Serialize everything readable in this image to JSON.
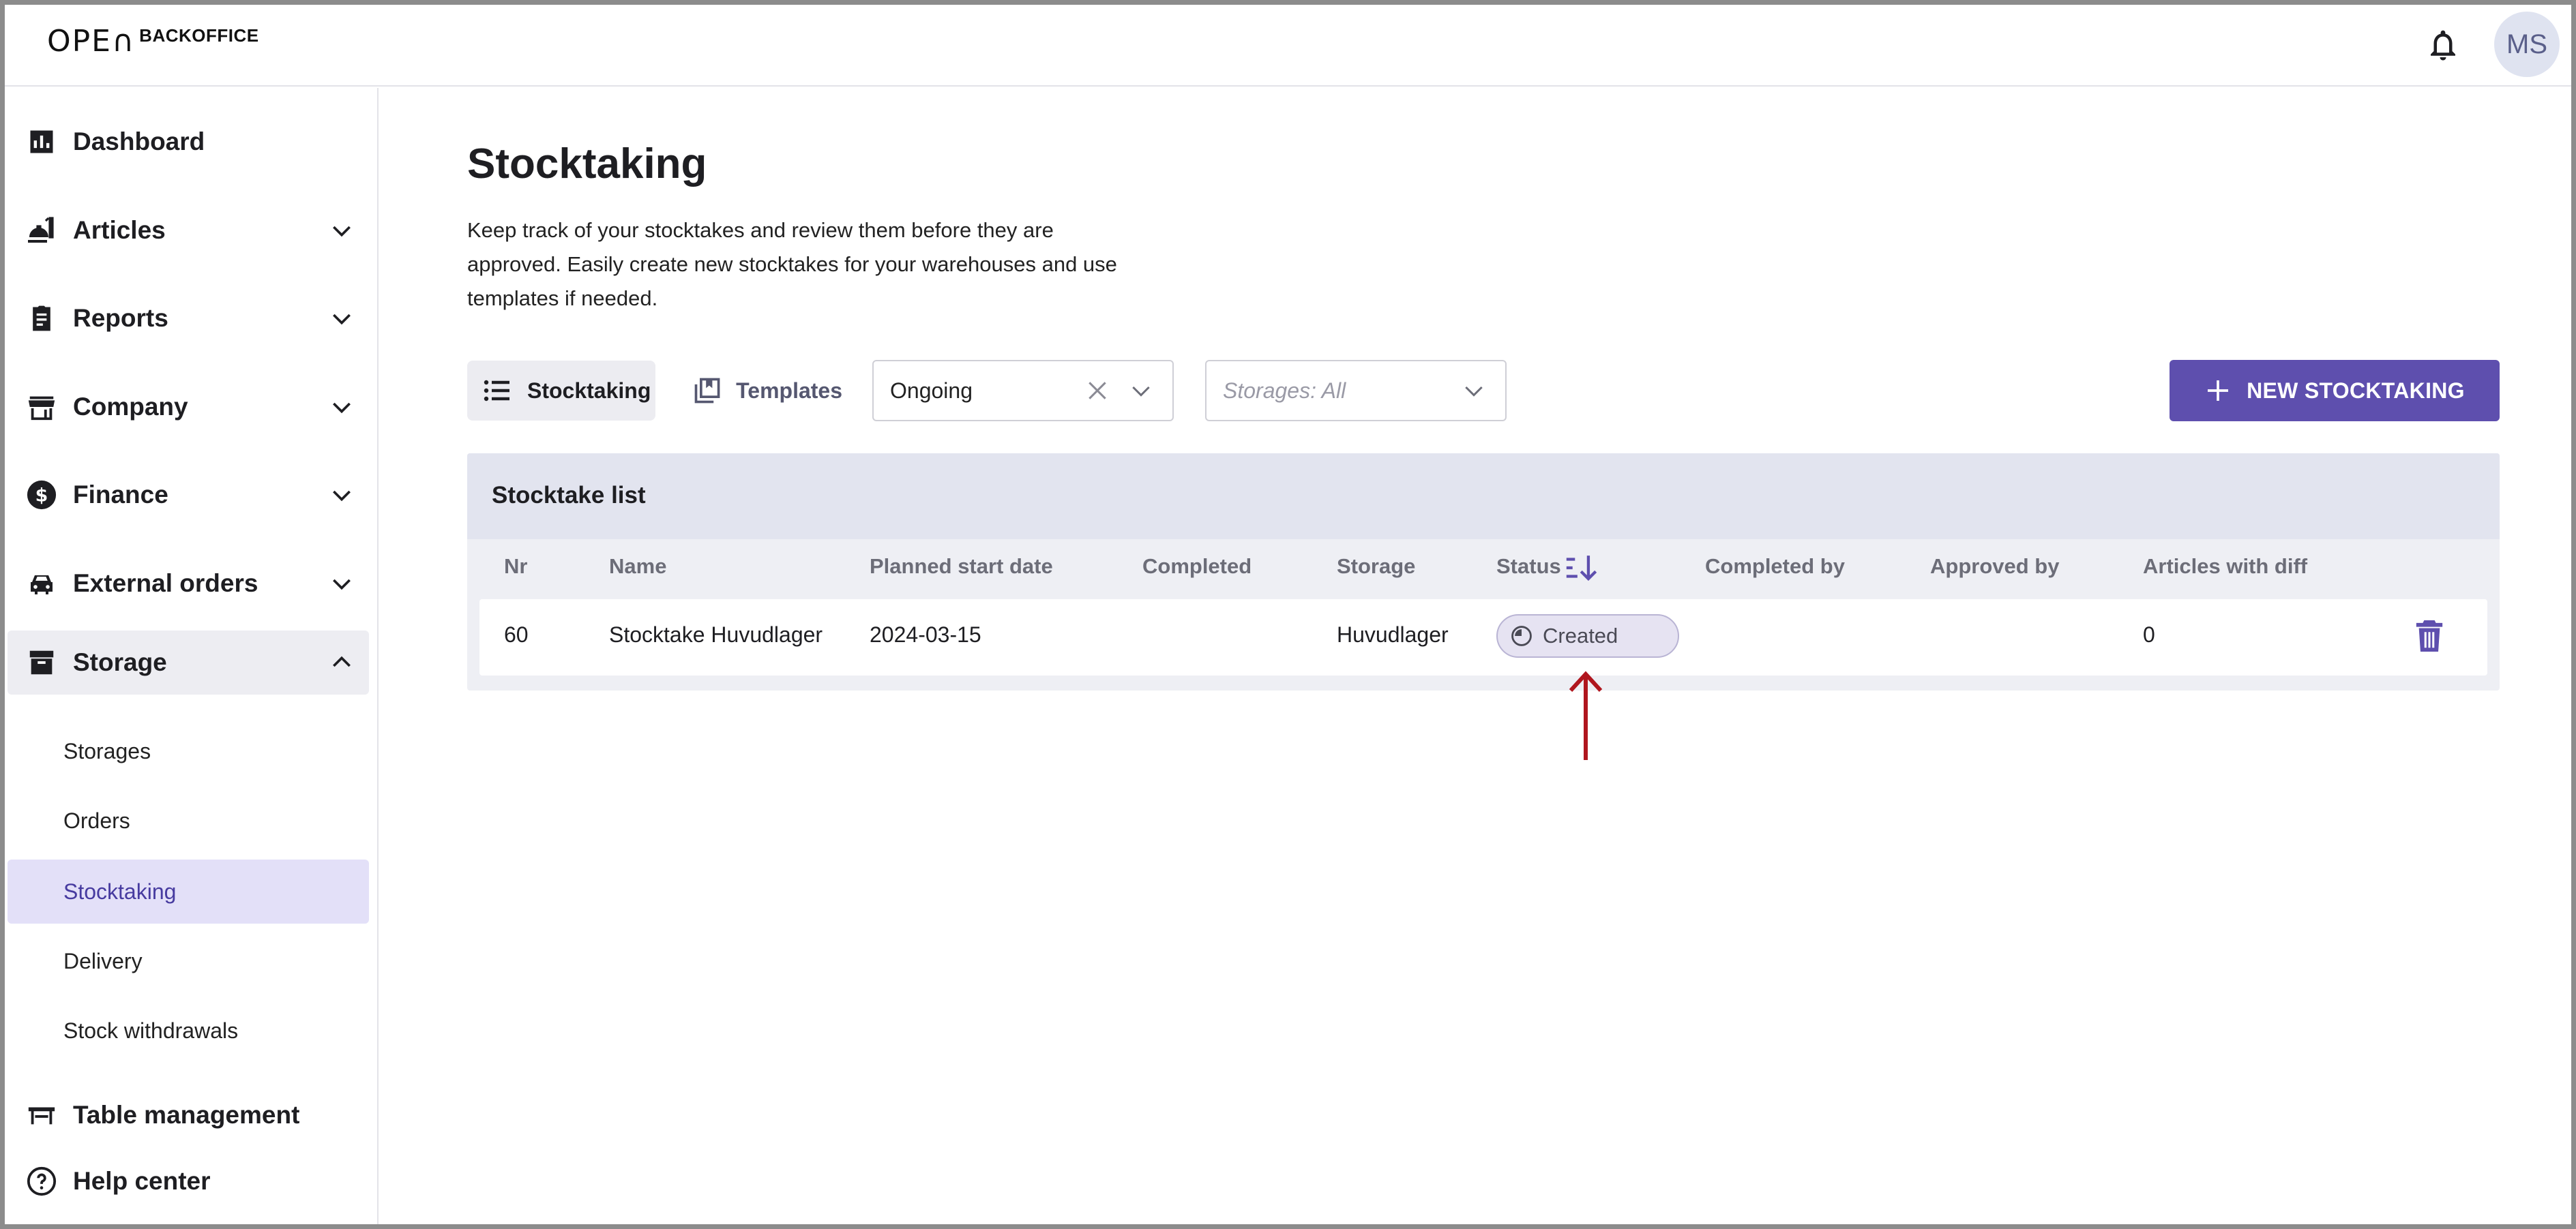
{
  "app": {
    "logo_mark": "OPE∩",
    "logo_text": "BACKOFFICE",
    "user_initials": "MS"
  },
  "sidebar": {
    "items": [
      {
        "label": "Dashboard",
        "icon": "bar-chart-icon"
      },
      {
        "label": "Articles",
        "icon": "food-icon"
      },
      {
        "label": "Reports",
        "icon": "clipboard-icon"
      },
      {
        "label": "Company",
        "icon": "store-icon"
      },
      {
        "label": "Finance",
        "icon": "dollar-icon"
      },
      {
        "label": "External orders",
        "icon": "car-icon"
      },
      {
        "label": "Storage",
        "icon": "archive-icon"
      }
    ],
    "storage_sub": [
      "Storages",
      "Orders",
      "Stocktaking",
      "Delivery",
      "Stock withdrawals"
    ],
    "bottom": [
      {
        "label": "Table management",
        "icon": "table-icon"
      },
      {
        "label": "Help center",
        "icon": "help-icon"
      }
    ]
  },
  "main": {
    "title": "Stocktaking",
    "description": "Keep track of your stocktakes and review them before they are approved. Easily create new stocktakes for your warehouses and use templates if needed.",
    "tabs": {
      "stocktaking": "Stocktaking",
      "templates": "Templates"
    },
    "status_filter": "Ongoing",
    "storage_filter": "Storages: All",
    "new_button": "NEW STOCKTAKING"
  },
  "table": {
    "title": "Stocktake list",
    "columns": [
      "Nr",
      "Name",
      "Planned start date",
      "Completed",
      "Storage",
      "Status",
      "Completed by",
      "Approved by",
      "Articles with diff"
    ],
    "rows": [
      {
        "nr": "60",
        "name": "Stocktake Huvudlager",
        "planned_start": "2024-03-15",
        "completed": "",
        "storage": "Huvudlager",
        "status": "Created",
        "completed_by": "",
        "approved_by": "",
        "articles_with_diff": "0"
      }
    ]
  },
  "colors": {
    "accent": "#5e4fae",
    "selected_bg": "#e3e0f8",
    "annotation_arrow": "#b0161e"
  }
}
